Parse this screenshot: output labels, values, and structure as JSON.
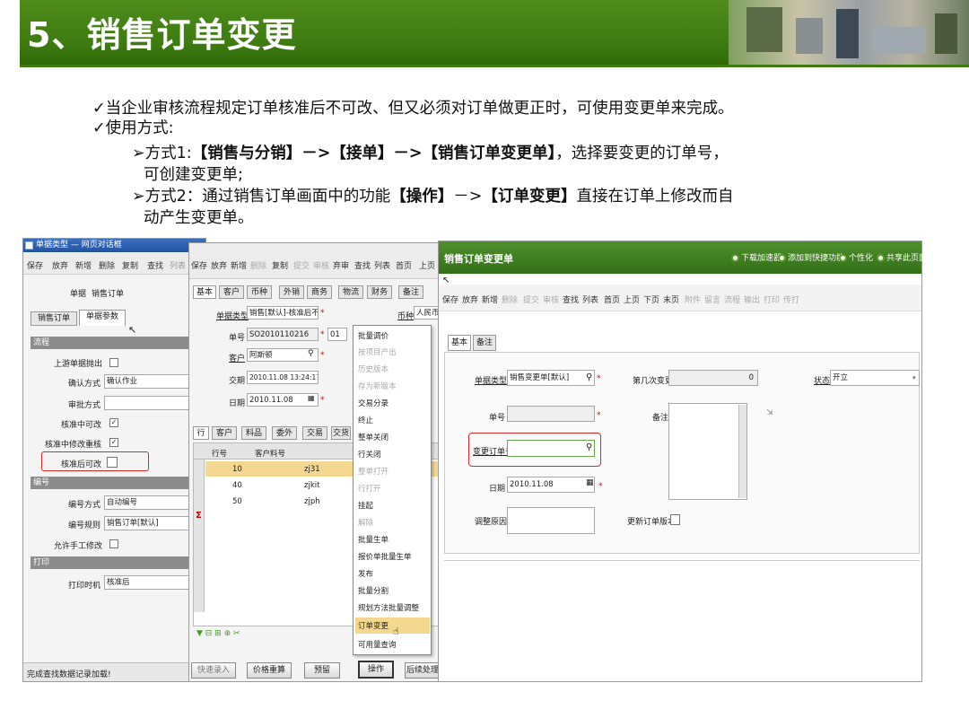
{
  "slide": {
    "title": "5、销售订单变更",
    "bullets": {
      "b1": "✓当企业审核流程规定订单核准后不可改、但又必须对订单做更正时，可使用变更单来完成。",
      "b2": "✓使用方式:",
      "m1_pre": "➢方式1:",
      "m1_bold": "【销售与分销】－>【接单】－>【销售订单变更单】",
      "m1_post": "，选择要变更的订单号，",
      "m1_line2": "可创建变更单;",
      "m2_pre": "➢方式2：通过销售订单画面中的功能",
      "m2_b1": "【操作】",
      "m2_mid": "－>",
      "m2_b2": "【订单变更】",
      "m2_post": "直接在订单上修改而自",
      "m2_line2": "动产生变更单。"
    }
  },
  "win1": {
    "title": "单据类型 — 网页对话框",
    "toolbar": [
      "保存",
      "放弃",
      "新增",
      "删除",
      "复制",
      "查找",
      "列表"
    ],
    "doc_label": "单据",
    "doc_value": "销售订单",
    "tabs": [
      "销售订单",
      "单据参数"
    ],
    "section_flow": "流程",
    "section_code": "编号",
    "section_print": "打印",
    "rows": {
      "upstream": "上游单据抛出",
      "confirm_mode": "确认方式",
      "confirm_value": "确认作业",
      "approve_mode": "审批方式",
      "editable_approving": "核准中可改",
      "reapprove": "核准中修改重核",
      "editable_after": "核准后可改",
      "code_mode": "编号方式",
      "code_mode_value": "自动编号",
      "code_rule": "编号规则",
      "code_rule_value": "销售订单[默认]",
      "manual_edit": "允许手工修改",
      "print_time": "打印时机",
      "print_time_value": "核准后"
    },
    "status": "完成查找数据记录加载!"
  },
  "win2": {
    "toolbar": [
      "保存",
      "放弃",
      "新增",
      "删除",
      "复制",
      "提交",
      "审核",
      "弃审",
      "查找",
      "列表",
      "首页",
      "上页"
    ],
    "tabs": [
      "基本",
      "客户",
      "币种",
      "外销",
      "商务",
      "物流",
      "财务",
      "备注"
    ],
    "fields": {
      "type_label": "单据类型",
      "type_value": "销售[默认]-核准后不",
      "no_label": "单号",
      "no_value": "SO2010110216",
      "customer_label": "客户",
      "customer_value": "阿斯顿",
      "delivery_label": "交期",
      "delivery_value": "2010.11.08 13:24:17",
      "date_label": "日期",
      "date_value": "2010.11.08",
      "currency_label": "币种",
      "currency_value": "人民币",
      "code_partial": "01"
    },
    "grid_tabs": [
      "行",
      "客户",
      "料品",
      "委外",
      "交易",
      "交货"
    ],
    "grid_headers": [
      "行号",
      "客户料号"
    ],
    "grid_rows": [
      {
        "no": "10",
        "item": "zj31"
      },
      {
        "no": "40",
        "item": "zjkit"
      },
      {
        "no": "50",
        "item": "zjph"
      }
    ],
    "sum_symbol": "Σ",
    "buttons": [
      "快速录入",
      "价格重算",
      "预留",
      "操作",
      "后续处理"
    ],
    "menu": [
      {
        "label": "批量调价",
        "enabled": true
      },
      {
        "label": "按项目产出",
        "enabled": false
      },
      {
        "label": "历史版本",
        "enabled": false
      },
      {
        "label": "存为新版本",
        "enabled": false
      },
      {
        "label": "交易分录",
        "enabled": true
      },
      {
        "label": "终止",
        "enabled": true
      },
      {
        "label": "整单关闭",
        "enabled": true
      },
      {
        "label": "行关闭",
        "enabled": true
      },
      {
        "label": "整单打开",
        "enabled": false
      },
      {
        "label": "行打开",
        "enabled": false
      },
      {
        "label": "挂起",
        "enabled": true
      },
      {
        "label": "解除",
        "enabled": false
      },
      {
        "label": "批量生单",
        "enabled": true
      },
      {
        "label": "报价单批量生单",
        "enabled": true
      },
      {
        "label": "发布",
        "enabled": true
      },
      {
        "label": "批量分割",
        "enabled": true
      },
      {
        "label": "规划方法批量调整",
        "enabled": true
      },
      {
        "label": "订单变更",
        "enabled": true
      },
      {
        "label": "可用量查询",
        "enabled": true
      }
    ]
  },
  "win3": {
    "title": "销售订单变更单",
    "links": [
      "下载加速器",
      "添加到快捷功能",
      "个性化",
      "共享此页面"
    ],
    "toolbar": [
      "保存",
      "放弃",
      "新增",
      "删除",
      "提交",
      "审核",
      "查找",
      "列表",
      "首页",
      "上页",
      "下页",
      "末页",
      "附件",
      "留言",
      "流程",
      "输出",
      "打印",
      "传打"
    ],
    "tabs": [
      "基本",
      "备注"
    ],
    "fields": {
      "type_label": "单据类型",
      "type_value": "销售变更单[默认]",
      "times_label": "第几次变更",
      "times_value": "0",
      "status_label": "状态",
      "status_value": "开立",
      "no_label": "单号",
      "remark_label": "备注",
      "change_order_label": "变更订单号",
      "date_label": "日期",
      "date_value": "2010.11.08",
      "reason_label": "调整原因",
      "update_version_label": "更新订单版本"
    }
  },
  "colors": {
    "banner_green": "#3d7a10",
    "title_bar_green": "#3f7f1e",
    "highlight_red": "#d42a2a",
    "menu_highlight": "#f5d890"
  }
}
